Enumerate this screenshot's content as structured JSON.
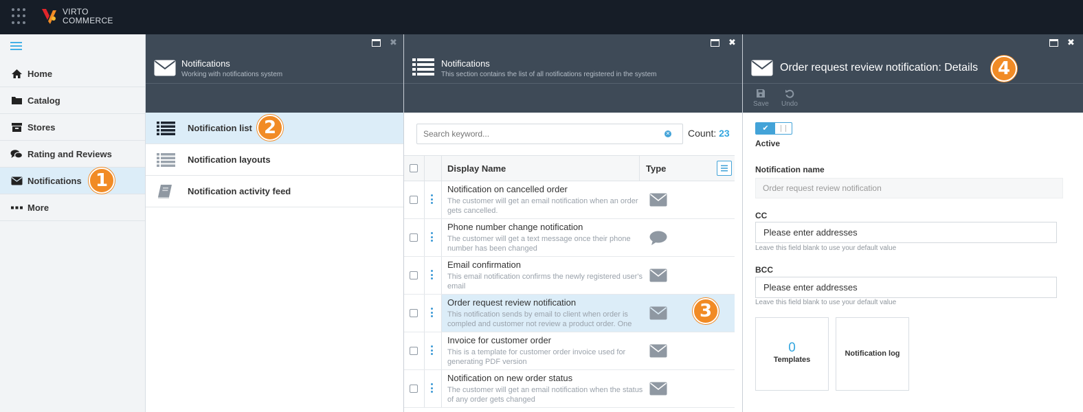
{
  "app": {
    "logo_line1": "VIRTO",
    "logo_line2": "COMMERCE",
    "brand_colors": {
      "orange": "#f18b25",
      "red": "#e2262b",
      "blue": "#43b0e6",
      "dark": "#161d27"
    }
  },
  "sidebar": {
    "items": [
      {
        "label": "Home",
        "icon": "home-icon"
      },
      {
        "label": "Catalog",
        "icon": "folder-icon"
      },
      {
        "label": "Stores",
        "icon": "archive-box-icon"
      },
      {
        "label": "Rating and Reviews",
        "icon": "comments-icon"
      },
      {
        "label": "Notifications",
        "icon": "envelope-icon",
        "active": true,
        "badge": "1"
      },
      {
        "label": "More",
        "icon": "ellipsis-icon"
      }
    ]
  },
  "blade1": {
    "title": "Notifications",
    "subtitle": "Working with notifications system",
    "items": [
      {
        "label": "Notification list",
        "icon": "list-icon",
        "active": true,
        "badge": "2"
      },
      {
        "label": "Notification layouts",
        "icon": "list-icon"
      },
      {
        "label": "Notification activity feed",
        "icon": "book-icon"
      }
    ]
  },
  "blade2": {
    "title": "Notifications",
    "subtitle": "This section contains the list of all notifications registered in the system",
    "search_placeholder": "Search keyword...",
    "count_label": "Count:",
    "count_value": "23",
    "columns": {
      "name": "Display Name",
      "type": "Type"
    },
    "badge": "3",
    "rows": [
      {
        "name": "Notification on cancelled order",
        "desc": "The customer will get an email notification when an order gets cancelled.",
        "type_icon": "envelope-icon"
      },
      {
        "name": "Phone number change notification",
        "desc": "The customer will get a text message once their phone number has been changed",
        "type_icon": "speech-bubble-icon"
      },
      {
        "name": "Email confirmation",
        "desc": "This email notification confirms the newly registered user's email",
        "type_icon": "envelope-icon"
      },
      {
        "name": "Order request review notification",
        "desc": "This notification sends by email to client when order is compled and customer not review a product order. One",
        "type_icon": "envelope-icon",
        "selected": true
      },
      {
        "name": "Invoice for customer order",
        "desc": "This is a template for customer order invoice used for generating PDF version",
        "type_icon": "envelope-icon"
      },
      {
        "name": "Notification on new order status",
        "desc": "The customer will get an email notification when the status of any order gets changed",
        "type_icon": "envelope-icon"
      }
    ]
  },
  "blade3": {
    "title": "Order request review notification: Details",
    "badge": "4",
    "toolbar": {
      "save": "Save",
      "undo": "Undo"
    },
    "active_label": "Active",
    "name_label": "Notification name",
    "name_value": "Order request review notification",
    "cc_label": "CC",
    "cc_placeholder": "Please enter addresses",
    "cc_hint": "Leave this field blank to use your default value",
    "bcc_label": "BCC",
    "bcc_placeholder": "Please enter addresses",
    "bcc_hint": "Leave this field blank to use your default value",
    "tiles": [
      {
        "count": "0",
        "label": "Templates"
      },
      {
        "label": "Notification log"
      }
    ]
  }
}
